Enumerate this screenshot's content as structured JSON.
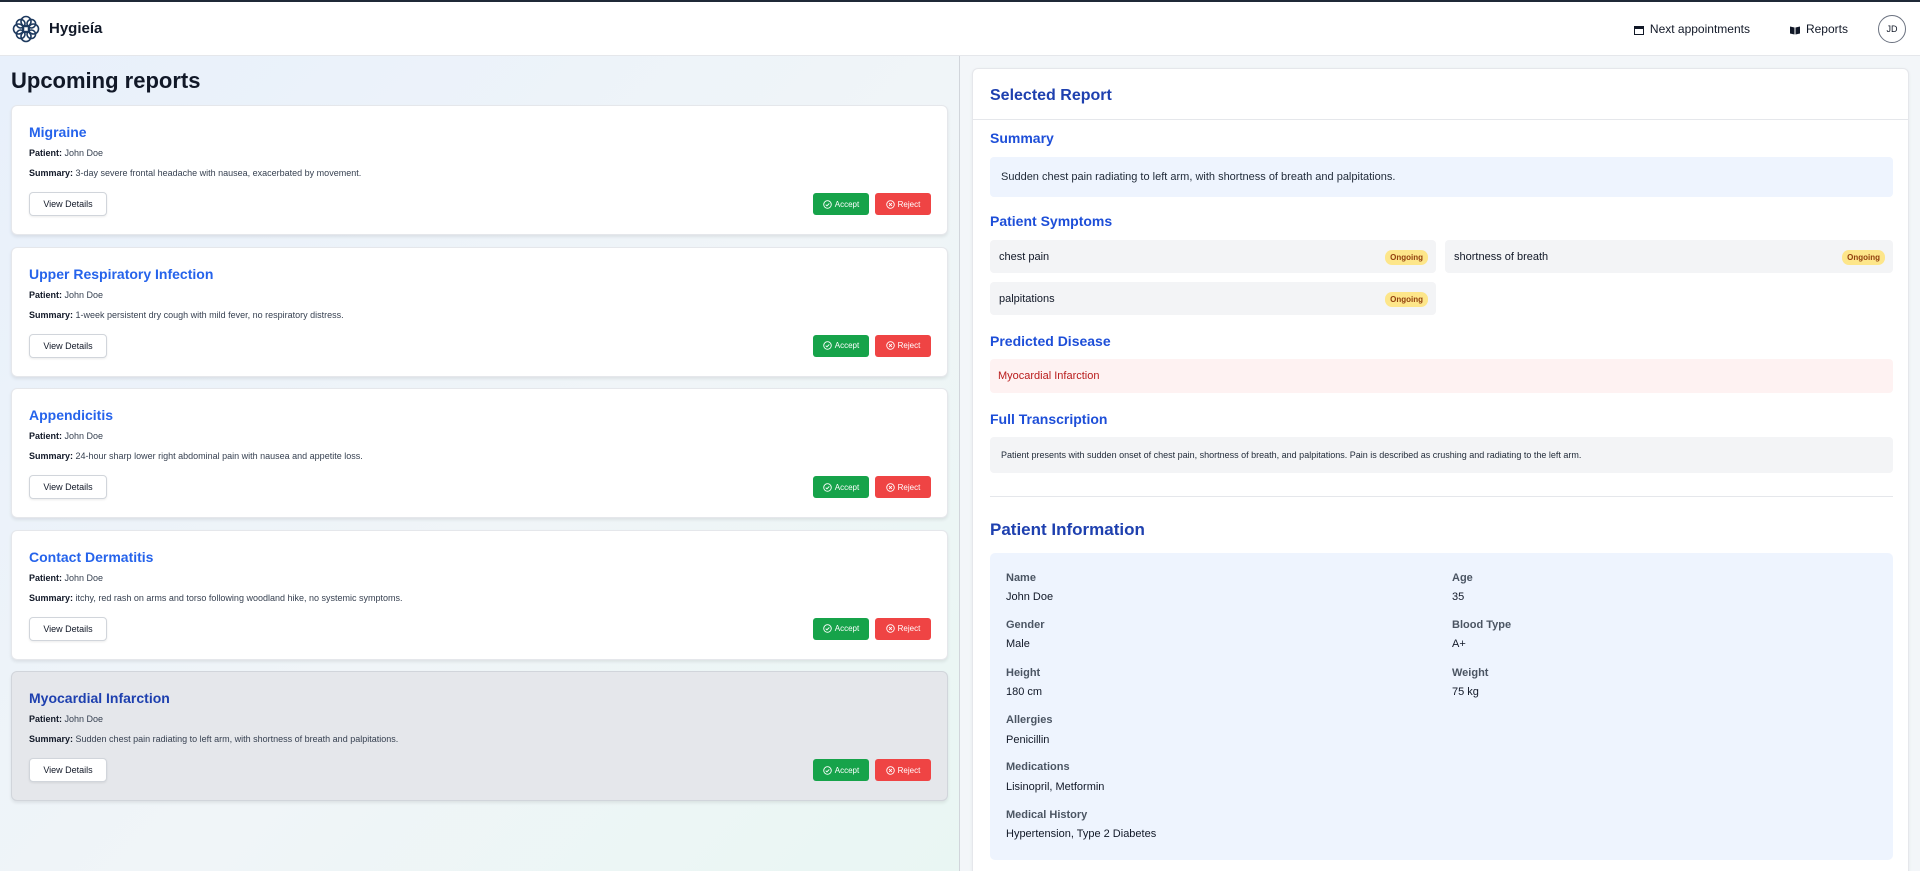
{
  "app": {
    "name": "Hygieía",
    "logo_icon": "flower-emblem-icon"
  },
  "nav": {
    "appointments_label": "Next appointments",
    "appointments_icon": "calendar-icon",
    "reports_label": "Reports",
    "reports_icon": "book-icon",
    "avatar_initials": "JD"
  },
  "list": {
    "title": "Upcoming reports",
    "patient_prefix": "Patient:",
    "summary_prefix": "Summary:",
    "view_label": "View Details",
    "accept_label": "Accept",
    "reject_label": "Reject",
    "reports": [
      {
        "title": "Migraine",
        "patient": "John Doe",
        "summary": "3-day severe frontal headache with nausea, exacerbated by movement.",
        "selected": false
      },
      {
        "title": "Upper Respiratory Infection",
        "patient": "John Doe",
        "summary": "1-week persistent dry cough with mild fever, no respiratory distress.",
        "selected": false
      },
      {
        "title": "Appendicitis",
        "patient": "John Doe",
        "summary": "24-hour sharp lower right abdominal pain with nausea and appetite loss.",
        "selected": false
      },
      {
        "title": "Contact Dermatitis",
        "patient": "John Doe",
        "summary": "itchy, red rash on arms and torso following woodland hike, no systemic symptoms.",
        "selected": false
      },
      {
        "title": "Myocardial Infarction",
        "patient": "John Doe",
        "summary": "Sudden chest pain radiating to left arm, with shortness of breath and palpitations.",
        "selected": true
      }
    ]
  },
  "selected": {
    "title": "Selected Report",
    "summary_heading": "Summary",
    "summary": "Sudden chest pain radiating to left arm, with shortness of breath and palpitations.",
    "symptoms_heading": "Patient Symptoms",
    "symptoms": [
      {
        "name": "chest pain",
        "status": "Ongoing"
      },
      {
        "name": "shortness of breath",
        "status": "Ongoing"
      },
      {
        "name": "palpitations",
        "status": "Ongoing"
      }
    ],
    "disease_heading": "Predicted Disease",
    "disease": "Myocardial Infarction",
    "transcription_heading": "Full Transcription",
    "transcription": "Patient presents with sudden onset of chest pain, shortness of breath, and palpitations. Pain is described as crushing and radiating to the left arm."
  },
  "patient": {
    "heading": "Patient Information",
    "name_label": "Name",
    "name": "John Doe",
    "age_label": "Age",
    "age": "35",
    "gender_label": "Gender",
    "gender": "Male",
    "blood_label": "Blood Type",
    "blood": "A+",
    "height_label": "Height",
    "height": "180 cm",
    "weight_label": "Weight",
    "weight": "75 kg",
    "allergies_label": "Allergies",
    "allergies": "Penicillin",
    "medications_label": "Medications",
    "medications": "Lisinopril, Metformin",
    "history_label": "Medical History",
    "history": "Hypertension, Type 2 Diabetes"
  },
  "colors": {
    "accent": "#2563eb",
    "accept": "#16a34a",
    "reject": "#ef4444",
    "badge": "#fde68a"
  }
}
